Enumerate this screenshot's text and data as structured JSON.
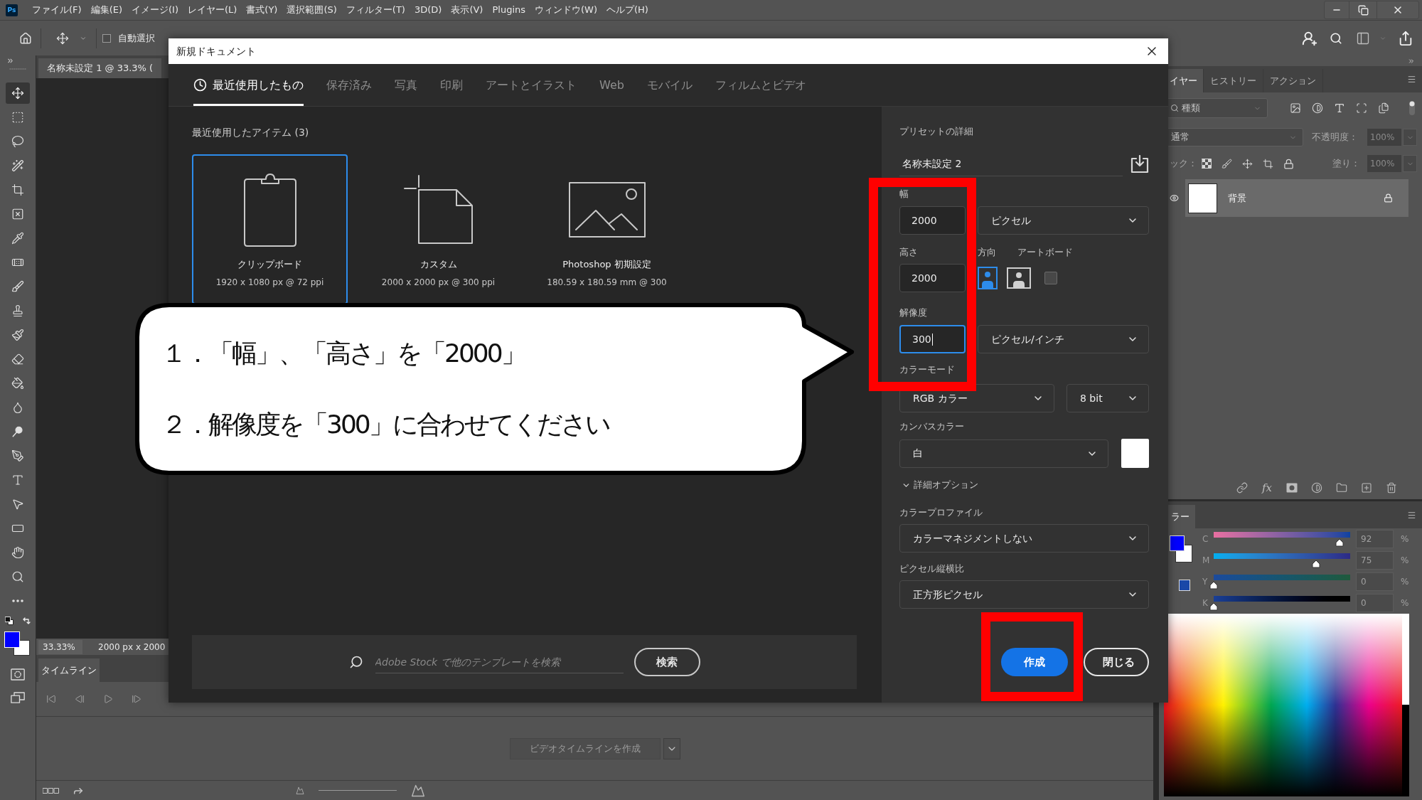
{
  "app": {
    "logo": "Ps",
    "menus": [
      "ファイル(F)",
      "編集(E)",
      "イメージ(I)",
      "レイヤー(L)",
      "書式(Y)",
      "選択範囲(S)",
      "フィルター(T)",
      "3D(D)",
      "表示(V)",
      "Plugins",
      "ウィンドウ(W)",
      "ヘルプ(H)"
    ]
  },
  "options_bar": {
    "auto_select": {
      "label": "自動選択",
      "checked": false
    }
  },
  "document_tab": {
    "title": "名称未設定 1 @ 33.3% ("
  },
  "tools": [
    {
      "kind": "move",
      "selected": true
    },
    {
      "kind": "marquee",
      "selected": false
    },
    {
      "kind": "lasso",
      "selected": false
    },
    {
      "kind": "quick_select",
      "selected": false
    },
    {
      "kind": "crop",
      "selected": false
    },
    {
      "kind": "frame",
      "selected": false
    },
    {
      "kind": "eyedropper",
      "selected": false
    },
    {
      "kind": "healing",
      "selected": false
    },
    {
      "kind": "brush",
      "selected": false
    },
    {
      "kind": "stamp",
      "selected": false
    },
    {
      "kind": "history_brush",
      "selected": false
    },
    {
      "kind": "eraser",
      "selected": false
    },
    {
      "kind": "bucket",
      "selected": false
    },
    {
      "kind": "blur",
      "selected": false
    },
    {
      "kind": "dodge",
      "selected": false
    },
    {
      "kind": "pen",
      "selected": false
    },
    {
      "kind": "type",
      "selected": false
    },
    {
      "kind": "path_select",
      "selected": false
    },
    {
      "kind": "shape",
      "selected": false
    },
    {
      "kind": "hand",
      "selected": false
    },
    {
      "kind": "zoom",
      "selected": false
    },
    {
      "kind": "more",
      "selected": false
    }
  ],
  "status_bar": {
    "zoom": "33.33%",
    "document_size": "2000 px x 2000"
  },
  "timeline": {
    "tab": {
      "label": "タイムライン",
      "selected": true
    },
    "create_button": "ビデオタイムラインを作成"
  },
  "layers_panel": {
    "tabs": [
      {
        "label": "イヤー",
        "selected": true
      },
      {
        "label": "ヒストリー",
        "selected": false
      },
      {
        "label": "アクション",
        "selected": false
      }
    ],
    "filter": "種類",
    "blend_mode": "通常",
    "opacity_label": "不透明度：",
    "opacity": "100%",
    "lock_label": "ック：",
    "fill_label": "塗り：",
    "fill": "100%",
    "layers": [
      {
        "name": "背景",
        "visible": true,
        "locked": true,
        "selected": true
      }
    ],
    "effects_button": "fx"
  },
  "color_panel": {
    "tab": "ラー",
    "channels": [
      {
        "label": "C",
        "level": 0.92,
        "value": "92",
        "unit": "%"
      },
      {
        "label": "M",
        "level": 0.75,
        "value": "75",
        "unit": "%"
      },
      {
        "label": "Y",
        "level": 0,
        "value": "0",
        "unit": "%"
      },
      {
        "label": "K",
        "level": 0,
        "value": "0",
        "unit": "%"
      }
    ]
  },
  "dialog": {
    "title": "新規ドキュメント",
    "tabs": [
      {
        "kind": "recent",
        "label": "最近使用したもの",
        "selected": true
      },
      {
        "kind": "category",
        "label": "保存済み",
        "selected": false
      },
      {
        "kind": "category",
        "label": "写真",
        "selected": false
      },
      {
        "kind": "category",
        "label": "印刷",
        "selected": false
      },
      {
        "kind": "category",
        "label": "アートとイラスト",
        "selected": false
      },
      {
        "kind": "category",
        "label": "Web",
        "selected": false
      },
      {
        "kind": "category",
        "label": "モバイル",
        "selected": false
      },
      {
        "kind": "category",
        "label": "フィルムとビデオ",
        "selected": false
      }
    ],
    "recent_heading": "最近使用したアイテム (3)",
    "presets": [
      {
        "kind": "clipboard",
        "name": "クリップボード",
        "detail": "1920 x 1080 px @ 72 ppi",
        "selected": true
      },
      {
        "kind": "custom",
        "name": "カスタム",
        "detail": "2000 x 2000 px @ 300 ppi",
        "selected": false
      },
      {
        "kind": "default",
        "name": "Photoshop 初期設定",
        "detail": "180.59 x 180.59 mm @ 300",
        "selected": false
      }
    ],
    "stock_search": {
      "placeholder": "Adobe Stock で他のテンプレートを検索",
      "button": "検索"
    },
    "preset_details": {
      "heading": "プリセットの詳細",
      "name": "名称未設定 2",
      "width": {
        "label": "幅",
        "value": "2000",
        "unit": "ピクセル"
      },
      "height": {
        "label": "高さ",
        "value": "2000"
      },
      "orientation": {
        "label": "方向",
        "options": [
          {
            "kind": "portrait",
            "selected": true
          },
          {
            "kind": "landscape",
            "selected": false
          }
        ]
      },
      "artboard": {
        "label": "アートボード",
        "checked": false
      },
      "resolution": {
        "label": "解像度",
        "value": "300",
        "focused": true,
        "unit": "ピクセル/インチ"
      },
      "color_mode": {
        "label": "カラーモード",
        "value": "RGB カラー",
        "bit_depth": "8 bit"
      },
      "canvas_color": {
        "label": "カンバスカラー",
        "value": "白"
      },
      "advanced": {
        "label": "詳細オプション",
        "expanded": true
      },
      "color_profile": {
        "label": "カラープロファイル",
        "value": "カラーマネジメントしない"
      },
      "pixel_aspect": {
        "label": "ピクセル縦横比",
        "value": "正方形ピクセル"
      }
    },
    "buttons": [
      {
        "kind": "primary",
        "label": "作成"
      },
      {
        "kind": "secondary",
        "label": "閉じる"
      }
    ]
  },
  "callout": {
    "lines": [
      "１．「幅」、「高さ」を「2000」",
      "２．解像度を「300」に合わせてください"
    ]
  }
}
